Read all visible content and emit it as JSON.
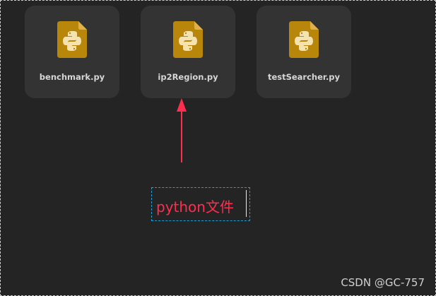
{
  "files": [
    {
      "name": "benchmark.py",
      "icon": "python-file-icon"
    },
    {
      "name": "ip2Region.py",
      "icon": "python-file-icon"
    },
    {
      "name": "testSearcher.py",
      "icon": "python-file-icon"
    }
  ],
  "annotation": {
    "text": "python文件"
  },
  "watermark": "CSDN @GC-757",
  "colors": {
    "background": "#242424",
    "tile": "#333333",
    "icon_gold": "#b8860b",
    "arrow": "#ff2e4e",
    "annotation_border": "#1e9fd6"
  }
}
